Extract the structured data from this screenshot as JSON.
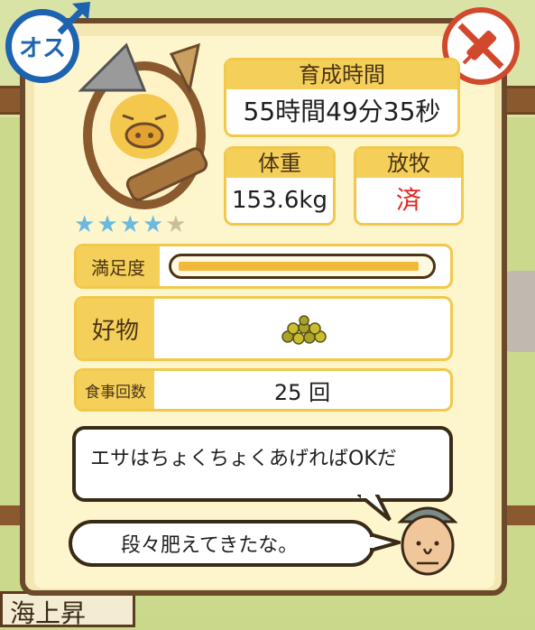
{
  "gender": {
    "label": "オス",
    "icon": "male-icon",
    "color": "#1d63b0"
  },
  "vaccine": {
    "icon": "no-syringe-icon",
    "color": "#d2482c"
  },
  "pig": {
    "stars_total": 5,
    "stars_filled": 4
  },
  "stats": {
    "growth_time": {
      "label": "育成時間",
      "value": "55時間49分35秒"
    },
    "weight": {
      "label": "体重",
      "value": "153.6kg"
    },
    "grazing": {
      "label": "放牧",
      "value": "済"
    }
  },
  "satisfaction": {
    "label": "満足度",
    "level": 0.97
  },
  "favorite": {
    "label": "好物",
    "item_icon": "feed-pellets-icon"
  },
  "meals": {
    "label": "食事回数",
    "value": "25 回"
  },
  "dialogue": {
    "line1": "エサはちょくちょくあげればOKだ",
    "line2": "段々肥えてきたな。"
  },
  "sign_text": "海上昇"
}
